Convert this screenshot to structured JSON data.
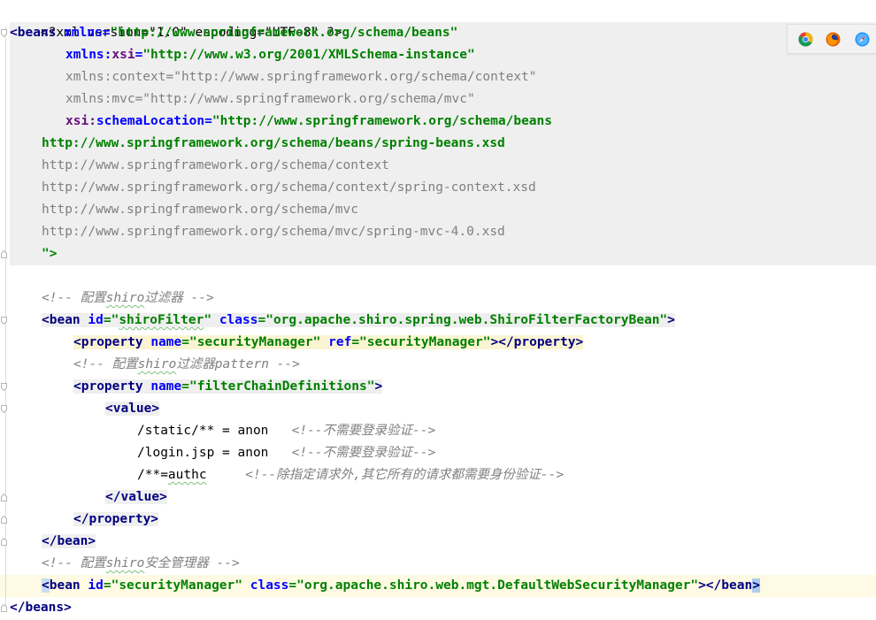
{
  "browser_icons": [
    "chrome-icon",
    "firefox-icon",
    "safari-icon"
  ],
  "code": {
    "l1_decl": "<?xml version=\"1.0\" encoding=\"UTF-8\" ?>",
    "l2_tag": "<beans",
    "l2_attr": "xmlns",
    "l2_val": "\"http://www.springframework.org/schema/beans\"",
    "l3_ns": "xmlns:",
    "l3_attr": "xsi",
    "l3_val": "\"http://www.w3.org/2001/XMLSchema-instance\"",
    "l4": "xmlns:context=\"http://www.springframework.org/schema/context\"",
    "l5": "xmlns:mvc=\"http://www.springframework.org/schema/mvc\"",
    "l6_ns": "xsi:",
    "l6_attr": "schemaLocation",
    "l6_val": "\"http://www.springframework.org/schema/beans",
    "l7": "http://www.springframework.org/schema/beans/spring-beans.xsd",
    "l8": "http://www.springframework.org/schema/context",
    "l9": "http://www.springframework.org/schema/context/spring-context.xsd",
    "l10": "http://www.springframework.org/schema/mvc",
    "l11": "http://www.springframework.org/schema/mvc/spring-mvc-4.0.xsd",
    "l12": "\">",
    "l14_pre": "<!-- 配置",
    "l14_sq": "shiro",
    "l14_post": "过滤器 -->",
    "l15_tag": "<bean",
    "l15_attr1": "id",
    "l15_val1a": "=\"",
    "l15_val1b": "shiroFilter",
    "l15_val1c": "\"",
    "l15_attr2": "class",
    "l15_val2": "=\"org.apache.shiro.spring.web.ShiroFilterFactoryBean\"",
    "l15_close": ">",
    "l16_tag": "<property",
    "l16_attr1": "name",
    "l16_val1": "=\"securityManager\"",
    "l16_attr2": "ref",
    "l16_val2": "=\"securityManager\"",
    "l16_close": "></property>",
    "l17_pre": "<!-- 配置",
    "l17_sq": "shiro",
    "l17_post": "过滤器pattern -->",
    "l18_tag": "<property",
    "l18_attr": "name",
    "l18_val": "=\"filterChainDefinitions\"",
    "l18_close": ">",
    "l19": "<value>",
    "l20_text": "/static/** = anon",
    "l20_comment": "<!--不需要登录验证-->",
    "l21_text": "/login.jsp = anon",
    "l21_comment": "<!--不需要登录验证-->",
    "l22_text_a": "/**=",
    "l22_text_b": "authc",
    "l22_comment": "<!--除指定请求外,其它所有的请求都需要身份验证-->",
    "l23": "</value>",
    "l24": "</property>",
    "l25": "</bean>",
    "l26_pre": "<!-- 配置",
    "l26_sq": "shiro",
    "l26_post": "安全管理器 -->",
    "l27_open": "<",
    "l27_tag": "bean",
    "l27_attr1": "id",
    "l27_val1": "=\"securityManager\"",
    "l27_attr2": "class",
    "l27_val2": "=\"org.apache.shiro.web.mgt.DefaultWebSecurityManager\"",
    "l27_close": "></bean",
    "l27_end": ">",
    "l28": "</beans>"
  }
}
